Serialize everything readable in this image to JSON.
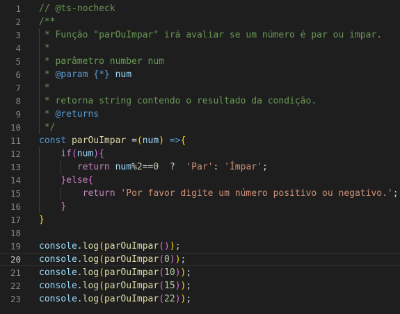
{
  "editor": {
    "active_line": 20,
    "lines": [
      {
        "n": "1",
        "tokens": [
          {
            "t": "// @ts-nocheck",
            "c": "comment"
          }
        ]
      },
      {
        "n": "2",
        "tokens": [
          {
            "t": "/**",
            "c": "comment"
          }
        ]
      },
      {
        "n": "3",
        "tokens": [
          {
            "t": " * Função \"parOuImpar\" irá avaliar se um número é par ou impar.",
            "c": "comment"
          }
        ]
      },
      {
        "n": "4",
        "tokens": [
          {
            "t": " *",
            "c": "comment"
          }
        ]
      },
      {
        "n": "5",
        "tokens": [
          {
            "t": " * parâmetro number num",
            "c": "comment"
          }
        ]
      },
      {
        "n": "6",
        "tokens": [
          {
            "t": " * ",
            "c": "comment"
          },
          {
            "t": "@param",
            "c": "tag"
          },
          {
            "t": " ",
            "c": "comment"
          },
          {
            "t": "{*}",
            "c": "keyword"
          },
          {
            "t": " ",
            "c": "comment"
          },
          {
            "t": "num",
            "c": "var"
          }
        ]
      },
      {
        "n": "7",
        "tokens": [
          {
            "t": " *",
            "c": "comment"
          }
        ]
      },
      {
        "n": "8",
        "tokens": [
          {
            "t": " * retorna string contendo o resultado da condição.",
            "c": "comment"
          }
        ]
      },
      {
        "n": "9",
        "tokens": [
          {
            "t": " * ",
            "c": "comment"
          },
          {
            "t": "@returns",
            "c": "tag"
          }
        ]
      },
      {
        "n": "10",
        "tokens": [
          {
            "t": " */",
            "c": "comment"
          }
        ]
      },
      {
        "n": "11",
        "tokens": [
          {
            "t": "const",
            "c": "keyword"
          },
          {
            "t": " ",
            "c": "punct"
          },
          {
            "t": "parOuImpar",
            "c": "func"
          },
          {
            "t": " =",
            "c": "punct"
          },
          {
            "t": "(",
            "c": "br1"
          },
          {
            "t": "num",
            "c": "var"
          },
          {
            "t": ")",
            "c": "br1"
          },
          {
            "t": " ",
            "c": "punct"
          },
          {
            "t": "=>",
            "c": "keyword"
          },
          {
            "t": "{",
            "c": "br1"
          }
        ]
      },
      {
        "n": "12",
        "tokens": [
          {
            "t": "    ",
            "c": "punct"
          },
          {
            "t": "if",
            "c": "control"
          },
          {
            "t": "(",
            "c": "br2"
          },
          {
            "t": "num",
            "c": "var"
          },
          {
            "t": ")",
            "c": "br2"
          },
          {
            "t": "{",
            "c": "br2"
          }
        ]
      },
      {
        "n": "13",
        "tokens": [
          {
            "t": "       ",
            "c": "punct"
          },
          {
            "t": "return",
            "c": "control"
          },
          {
            "t": " ",
            "c": "punct"
          },
          {
            "t": "num",
            "c": "var"
          },
          {
            "t": "%",
            "c": "punct"
          },
          {
            "t": "2",
            "c": "num"
          },
          {
            "t": "==",
            "c": "punct"
          },
          {
            "t": "0",
            "c": "num"
          },
          {
            "t": "  ?  ",
            "c": "punct"
          },
          {
            "t": "'Par'",
            "c": "str"
          },
          {
            "t": ": ",
            "c": "punct"
          },
          {
            "t": "'Ímpar'",
            "c": "str"
          },
          {
            "t": ";",
            "c": "punct"
          }
        ]
      },
      {
        "n": "14",
        "tokens": [
          {
            "t": "    ",
            "c": "punct"
          },
          {
            "t": "}",
            "c": "br2"
          },
          {
            "t": "else",
            "c": "control"
          },
          {
            "t": "{",
            "c": "br2"
          }
        ]
      },
      {
        "n": "15",
        "tokens": [
          {
            "t": "        ",
            "c": "punct"
          },
          {
            "t": "return",
            "c": "control"
          },
          {
            "t": " ",
            "c": "punct"
          },
          {
            "t": "'Por favor digite um número positivo ou negativo.'",
            "c": "str"
          },
          {
            "t": ";",
            "c": "punct"
          }
        ]
      },
      {
        "n": "16",
        "tokens": [
          {
            "t": "    ",
            "c": "punct"
          },
          {
            "t": "}",
            "c": "br2"
          }
        ]
      },
      {
        "n": "17",
        "tokens": [
          {
            "t": "}",
            "c": "br1"
          }
        ]
      },
      {
        "n": "18",
        "tokens": []
      },
      {
        "n": "19",
        "tokens": [
          {
            "t": "console",
            "c": "var"
          },
          {
            "t": ".",
            "c": "punct"
          },
          {
            "t": "log",
            "c": "func"
          },
          {
            "t": "(",
            "c": "br1"
          },
          {
            "t": "parOuImpar",
            "c": "func"
          },
          {
            "t": "(",
            "c": "br2"
          },
          {
            "t": ")",
            "c": "br2"
          },
          {
            "t": ")",
            "c": "br1"
          },
          {
            "t": ";",
            "c": "punct"
          }
        ]
      },
      {
        "n": "20",
        "tokens": [
          {
            "t": "console",
            "c": "var"
          },
          {
            "t": ".",
            "c": "punct"
          },
          {
            "t": "log",
            "c": "func"
          },
          {
            "t": "(",
            "c": "br1"
          },
          {
            "t": "parOuImpar",
            "c": "func"
          },
          {
            "t": "(",
            "c": "br2"
          },
          {
            "t": "0",
            "c": "num"
          },
          {
            "t": ")",
            "c": "br2"
          },
          {
            "t": ")",
            "c": "br1"
          },
          {
            "t": ";",
            "c": "punct"
          }
        ]
      },
      {
        "n": "21",
        "tokens": [
          {
            "t": "console",
            "c": "var"
          },
          {
            "t": ".",
            "c": "punct"
          },
          {
            "t": "log",
            "c": "func"
          },
          {
            "t": "(",
            "c": "br1"
          },
          {
            "t": "parOuImpar",
            "c": "func"
          },
          {
            "t": "(",
            "c": "br2"
          },
          {
            "t": "10",
            "c": "num"
          },
          {
            "t": ")",
            "c": "br2"
          },
          {
            "t": ")",
            "c": "br1"
          },
          {
            "t": ";",
            "c": "punct"
          }
        ]
      },
      {
        "n": "22",
        "tokens": [
          {
            "t": "console",
            "c": "var"
          },
          {
            "t": ".",
            "c": "punct"
          },
          {
            "t": "log",
            "c": "func"
          },
          {
            "t": "(",
            "c": "br1"
          },
          {
            "t": "parOuImpar",
            "c": "func"
          },
          {
            "t": "(",
            "c": "br2"
          },
          {
            "t": "15",
            "c": "num"
          },
          {
            "t": ")",
            "c": "br2"
          },
          {
            "t": ")",
            "c": "br1"
          },
          {
            "t": ";",
            "c": "punct"
          }
        ]
      },
      {
        "n": "23",
        "tokens": [
          {
            "t": "console",
            "c": "var"
          },
          {
            "t": ".",
            "c": "punct"
          },
          {
            "t": "log",
            "c": "func"
          },
          {
            "t": "(",
            "c": "br1"
          },
          {
            "t": "parOuImpar",
            "c": "func"
          },
          {
            "t": "(",
            "c": "br2"
          },
          {
            "t": "22",
            "c": "num"
          },
          {
            "t": ")",
            "c": "br2"
          },
          {
            "t": ")",
            "c": "br1"
          },
          {
            "t": ";",
            "c": "punct"
          }
        ]
      }
    ]
  },
  "theme": {
    "background": "#1e1e1e",
    "comment": "#6a9955",
    "keyword": "#569cd6",
    "control": "#c586c0",
    "function": "#dcdcaa",
    "variable": "#9cdcfe",
    "string": "#ce9178",
    "number": "#b5cea8",
    "bracket_1": "#ffd700",
    "bracket_2": "#da70d6"
  }
}
